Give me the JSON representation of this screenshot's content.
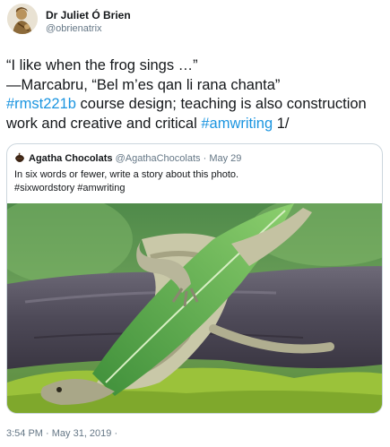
{
  "author": {
    "name": "Dr Juliet Ó Brien",
    "handle": "@obrienatrix",
    "avatar_icon": "portrait-sketch-icon"
  },
  "tweet": {
    "line1": "“I like when the frog sings …”",
    "line2": "—Marcabru, “Bel m’es qan li rana chanta”",
    "hashtag1": "#rmst221b",
    "text_after_hashtag1": " course design; teaching is also construction work and creative and critical ",
    "hashtag2": "#amwriting",
    "text_end": " 1/"
  },
  "quoted": {
    "logo_icon": "chocolate-logo-icon",
    "name": "Agatha Chocolats",
    "handle": "@AgathaChocolats",
    "separator": " · ",
    "date": "May 29",
    "text_line1": "In six words or fewer, write a story about this photo.",
    "text_line2": "#sixwordstory #amwriting"
  },
  "footer": {
    "timestamp": "3:54 PM · May 31, 2019 ·"
  },
  "colors": {
    "link": "#1b95e0",
    "muted": "#657786",
    "border": "#ccd6dd"
  }
}
